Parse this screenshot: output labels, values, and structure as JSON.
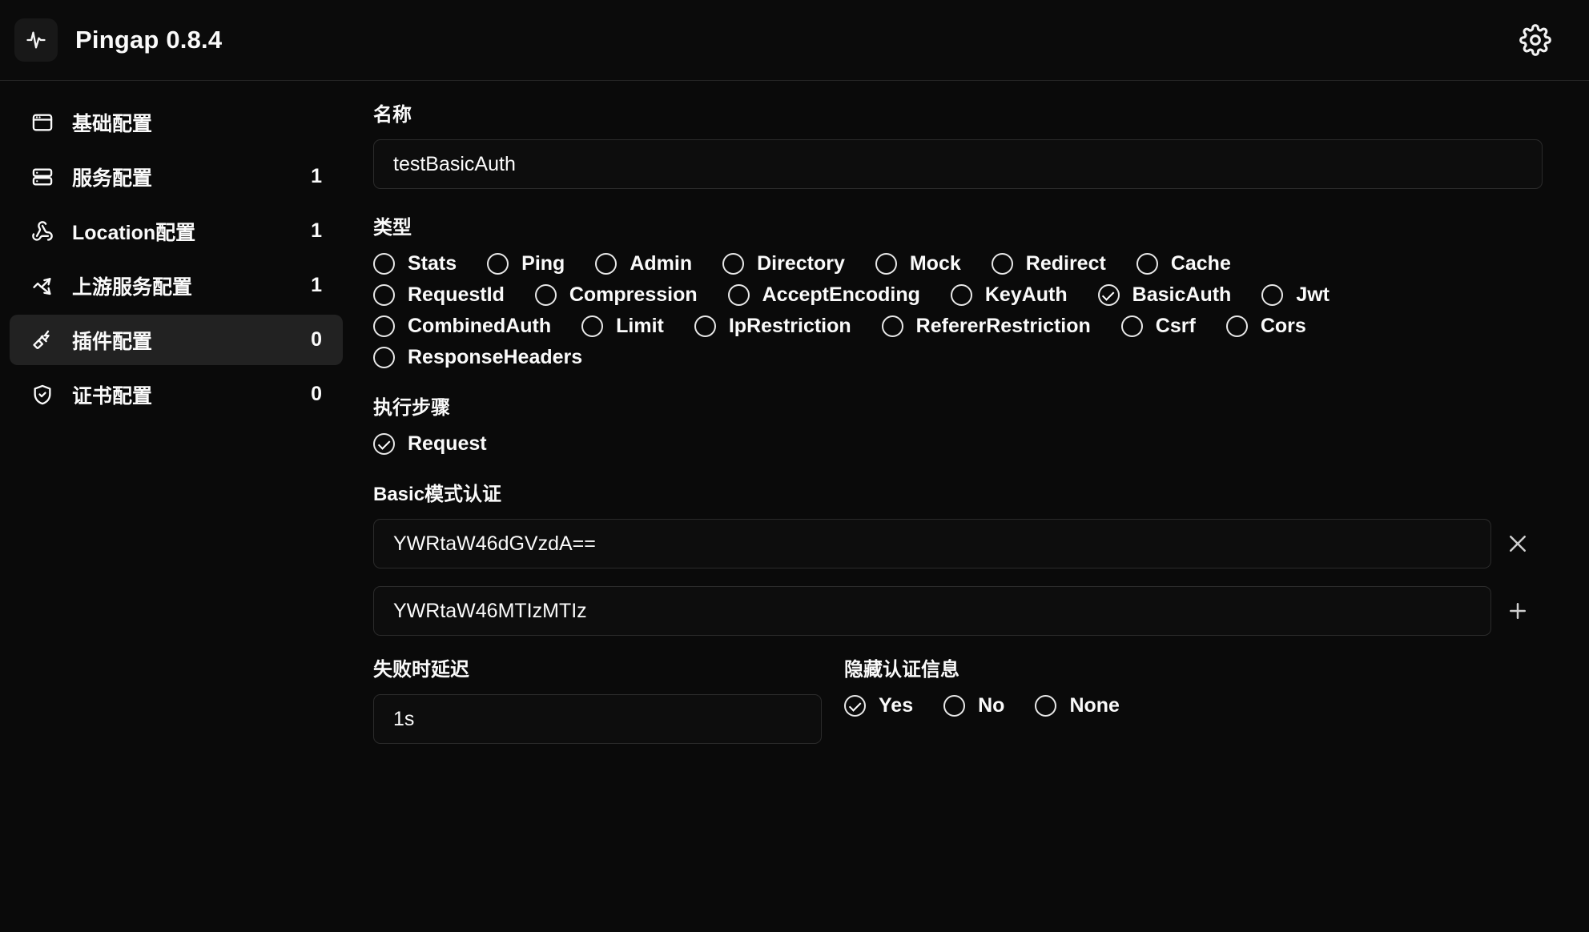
{
  "header": {
    "logo_icon": "activity-pulse-icon",
    "title": "Pingap  0.8.4",
    "settings_icon": "gear-icon"
  },
  "sidebar": {
    "items": [
      {
        "label": "基础配置",
        "badge": "",
        "icon": "app-window-icon",
        "active": false
      },
      {
        "label": "服务配置",
        "badge": "1",
        "icon": "server-icon",
        "active": false
      },
      {
        "label": "Location配置",
        "badge": "1",
        "icon": "webhook-icon",
        "active": false
      },
      {
        "label": "上游服务配置",
        "badge": "1",
        "icon": "network-arrows-icon",
        "active": false
      },
      {
        "label": "插件配置",
        "badge": "0",
        "icon": "plug-zap-icon",
        "active": true
      },
      {
        "label": "证书配置",
        "badge": "0",
        "icon": "shield-check-icon",
        "active": false
      }
    ]
  },
  "main": {
    "name_field": {
      "label": "名称",
      "value": "testBasicAuth"
    },
    "category": {
      "label": "类型",
      "rows": [
        [
          {
            "label": "Stats",
            "checked": false
          },
          {
            "label": "Ping",
            "checked": false
          },
          {
            "label": "Admin",
            "checked": false
          },
          {
            "label": "Directory",
            "checked": false
          },
          {
            "label": "Mock",
            "checked": false
          },
          {
            "label": "Redirect",
            "checked": false
          },
          {
            "label": "Cache",
            "checked": false
          }
        ],
        [
          {
            "label": "RequestId",
            "checked": false
          },
          {
            "label": "Compression",
            "checked": false
          },
          {
            "label": "AcceptEncoding",
            "checked": false
          },
          {
            "label": "KeyAuth",
            "checked": false
          },
          {
            "label": "BasicAuth",
            "checked": true
          },
          {
            "label": "Jwt",
            "checked": false
          }
        ],
        [
          {
            "label": "CombinedAuth",
            "checked": false
          },
          {
            "label": "Limit",
            "checked": false
          },
          {
            "label": "IpRestriction",
            "checked": false
          },
          {
            "label": "RefererRestriction",
            "checked": false
          },
          {
            "label": "Csrf",
            "checked": false
          },
          {
            "label": "Cors",
            "checked": false
          }
        ],
        [
          {
            "label": "ResponseHeaders",
            "checked": false
          }
        ]
      ]
    },
    "step": {
      "label": "执行步骤",
      "options": [
        {
          "label": "Request",
          "checked": true
        }
      ]
    },
    "basic_auth": {
      "label": "Basic模式认证",
      "entries": [
        {
          "value": "YWRtaW46dGVzdA==",
          "action_icon": "close-icon",
          "action": "remove"
        },
        {
          "value": "YWRtaW46MTIzMTIz",
          "action_icon": "plus-icon",
          "action": "add"
        }
      ]
    },
    "delay": {
      "label": "失败时延迟",
      "value": "1s"
    },
    "hide_credentials": {
      "label": "隐藏认证信息",
      "options": [
        {
          "label": "Yes",
          "checked": true
        },
        {
          "label": "No",
          "checked": false
        },
        {
          "label": "None",
          "checked": false
        }
      ]
    }
  },
  "colors": {
    "background": "#0a0a0a",
    "panel": "#0b0b0b",
    "active_item": "#222222",
    "border": "#2b2b2b",
    "text": "#fafafa"
  }
}
